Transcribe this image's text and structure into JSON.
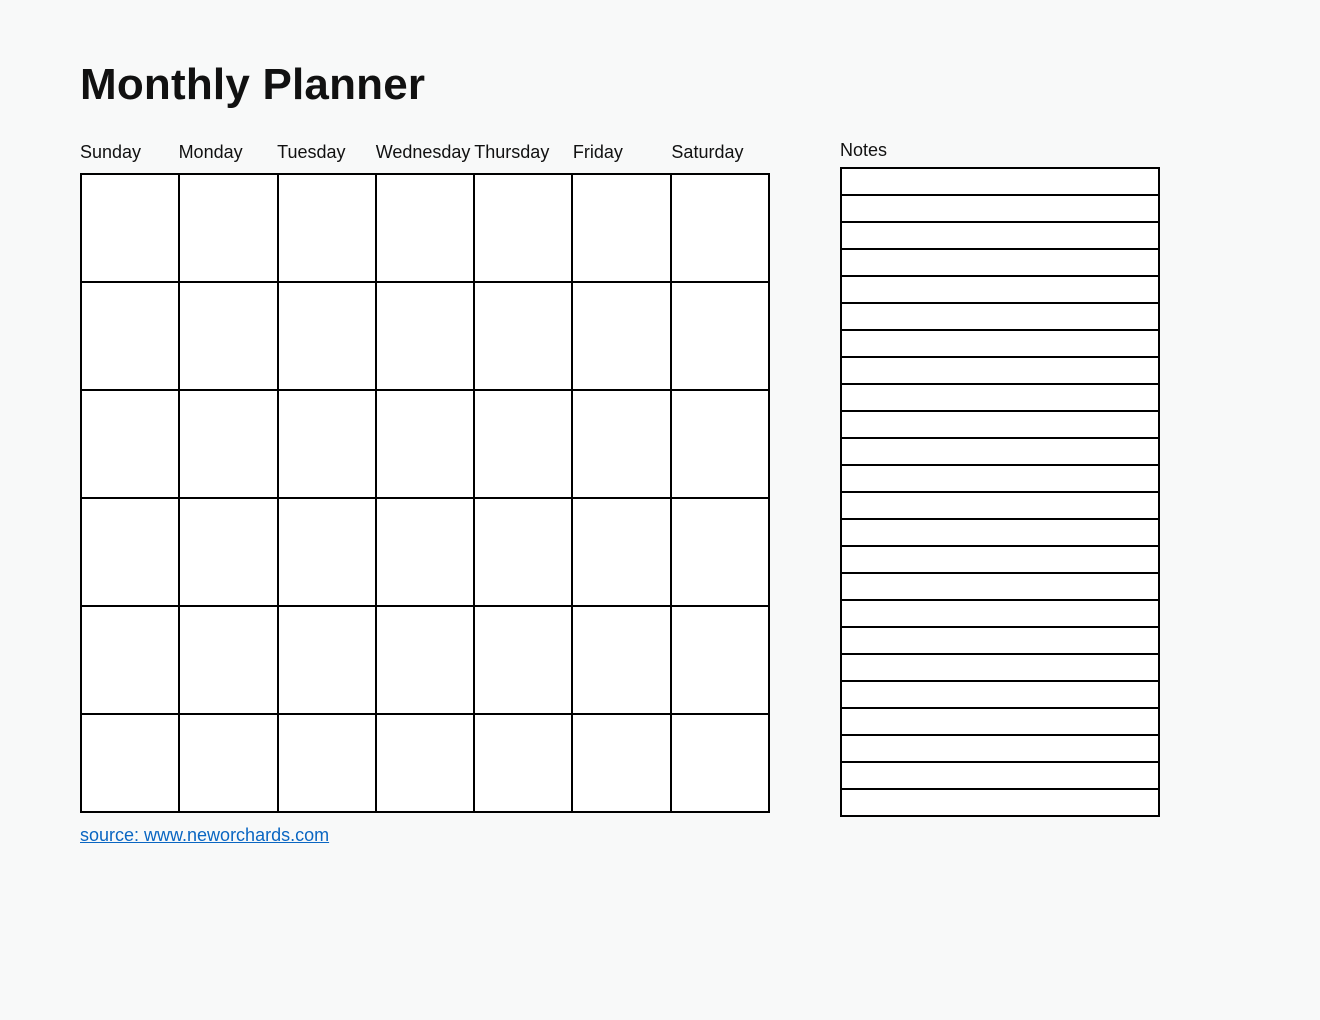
{
  "title": "Monthly Planner",
  "days": [
    "Sunday",
    "Monday",
    "Tuesday",
    "Wednesday",
    "Thursday",
    "Friday",
    "Saturday"
  ],
  "calendar_rows": 6,
  "notes": {
    "title": "Notes",
    "line_count": 24
  },
  "source_label": "source: www.neworchards.com"
}
